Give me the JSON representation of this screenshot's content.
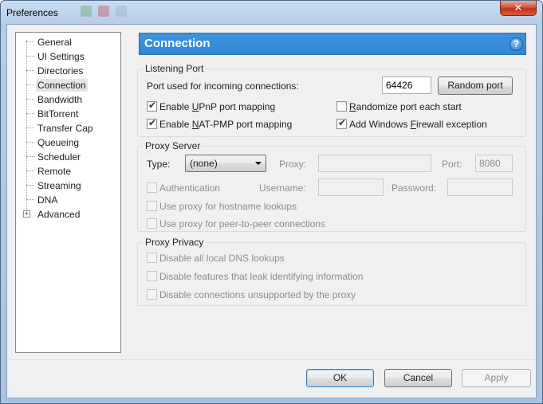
{
  "window": {
    "title": "Preferences",
    "close_glyph": "✕"
  },
  "tree": {
    "items": [
      {
        "label": "General"
      },
      {
        "label": "UI Settings"
      },
      {
        "label": "Directories"
      },
      {
        "label": "Connection"
      },
      {
        "label": "Bandwidth"
      },
      {
        "label": "BitTorrent"
      },
      {
        "label": "Transfer Cap"
      },
      {
        "label": "Queueing"
      },
      {
        "label": "Scheduler"
      },
      {
        "label": "Remote"
      },
      {
        "label": "Streaming"
      },
      {
        "label": "DNA"
      },
      {
        "label": "Advanced"
      }
    ],
    "selected": "Connection",
    "expander_glyph": "+"
  },
  "header": {
    "title": "Connection",
    "help_glyph": "?"
  },
  "listening_port": {
    "group_title": "Listening Port",
    "port_label": "Port used for incoming connections:",
    "port_value": "64426",
    "random_port_label": "Random port",
    "upnp": {
      "pre": "Enable ",
      "u": "U",
      "post": "PnP port mapping",
      "checked": true
    },
    "natpmp": {
      "pre": "Enable ",
      "u": "N",
      "post": "AT-PMP port mapping",
      "checked": true
    },
    "randomize": {
      "pre": "",
      "u": "R",
      "post": "andomize port each start",
      "checked": false
    },
    "firewall": {
      "pre": "Add Windows ",
      "u": "F",
      "post": "irewall exception",
      "checked": true
    }
  },
  "proxy_server": {
    "group_title": "Proxy Server",
    "type_label": "Type:",
    "type_value": "(none)",
    "proxy_label": "Proxy:",
    "proxy_value": "",
    "port_label": "Port:",
    "port_value": "8080",
    "authentication_label": "Authentication",
    "username_label": "Username:",
    "username_value": "",
    "password_label": "Password:",
    "password_value": "",
    "hostname_lookups_label": "Use proxy for hostname lookups",
    "p2p_label": "Use proxy for peer-to-peer connections"
  },
  "proxy_privacy": {
    "group_title": "Proxy Privacy",
    "dns_label": "Disable all local DNS lookups",
    "leak_label": "Disable features that leak identifying information",
    "unsupported_label": "Disable connections unsupported by the proxy"
  },
  "buttons": {
    "ok": "OK",
    "cancel": "Cancel",
    "apply": "Apply"
  },
  "colors": {
    "header_bg": "#2f86d6",
    "close_red": "#c0301b"
  }
}
